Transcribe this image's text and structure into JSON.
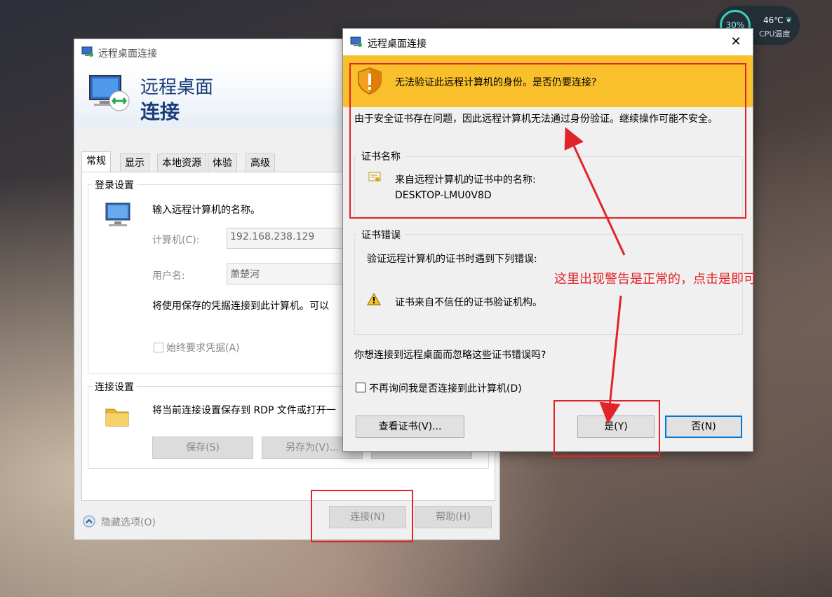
{
  "cpu_widget": {
    "percent": "30%",
    "temp": "46℃",
    "label": "CPU温度"
  },
  "back_window": {
    "title": "远程桌面连接",
    "banner_line1": "远程桌面",
    "banner_line2": "连接",
    "tabs": [
      "常规",
      "显示",
      "本地资源",
      "体验",
      "高级"
    ],
    "login_group": {
      "label": "登录设置",
      "prompt": "输入远程计算机的名称。",
      "computer_label": "计算机(C):",
      "computer_value": "192.168.238.129",
      "username_label": "用户名:",
      "username_value": "萧楚河",
      "saved_creds_text": "将使用保存的凭据连接到此计算机。可以",
      "always_ask_label": "始终要求凭据(A)"
    },
    "conn_group": {
      "label": "连接设置",
      "text": "将当前连接设置保存到 RDP 文件或打开一",
      "save_btn": "保存(S)",
      "saveas_btn": "另存为(V)..."
    },
    "hide_options": "隐藏选项(O)",
    "connect_btn": "连接(N)",
    "help_btn": "帮助(H)"
  },
  "front_dialog": {
    "title": "远程桌面连接",
    "warning": "无法验证此远程计算机的身份。是否仍要连接?",
    "description": "由于安全证书存在问题，因此远程计算机无法通过身份验证。继续操作可能不安全。",
    "cert_name": {
      "label": "证书名称",
      "line1": "来自远程计算机的证书中的名称:",
      "line2": "DESKTOP-LMU0V8D"
    },
    "cert_error": {
      "label": "证书错误",
      "line1": "验证远程计算机的证书时遇到下列错误:",
      "line2": "证书来自不信任的证书验证机构。"
    },
    "question": "你想连接到远程桌面而忽略这些证书错误吗?",
    "dont_ask": "不再询问我是否连接到此计算机(D)",
    "view_cert_btn": "查看证书(V)...",
    "yes_btn": "是(Y)",
    "no_btn": "否(N)"
  },
  "annotation": {
    "text": "这里出现警告是正常的，点击是即可",
    "color": "#e0242a"
  }
}
